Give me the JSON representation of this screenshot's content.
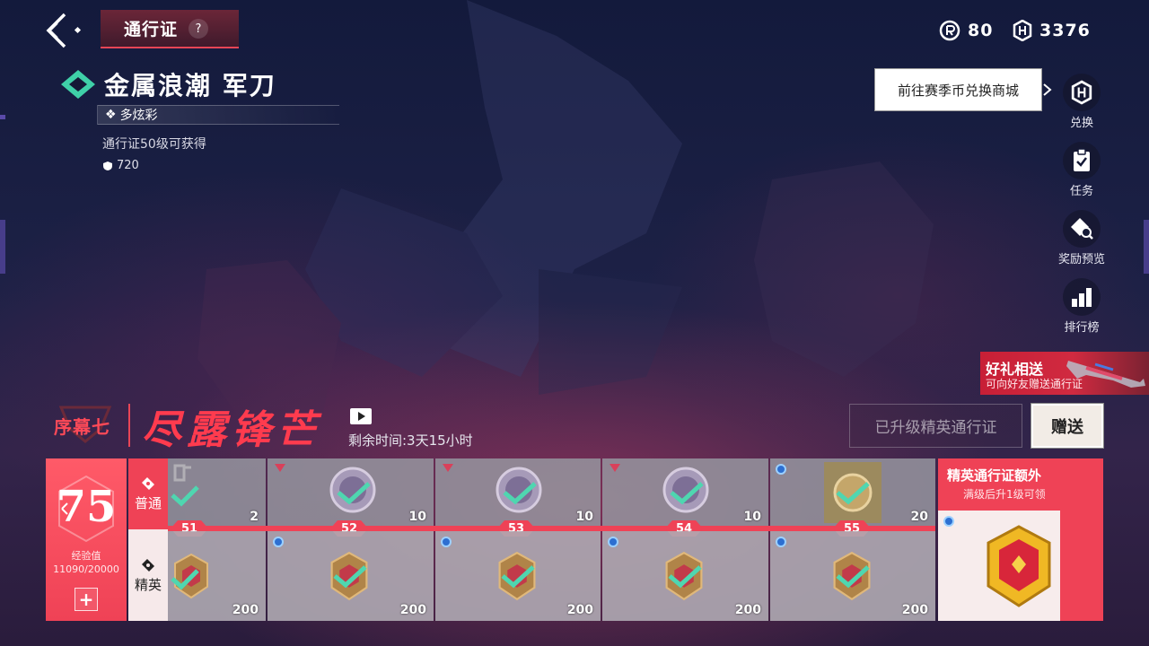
{
  "header": {
    "title": "通行证",
    "help": "?",
    "currencies": [
      {
        "icon": "radianite-icon",
        "value": "80"
      },
      {
        "icon": "kingdom-credit-icon",
        "value": "3376"
      }
    ]
  },
  "item": {
    "name": "金属浪潮 军刀",
    "variant": "多炫彩",
    "unlock_text": "通行证50级可获得",
    "points": "720"
  },
  "side_menu": {
    "tooltip": "前往赛季币兑换商城",
    "items": [
      {
        "icon": "exchange-icon",
        "label": "兑换"
      },
      {
        "icon": "missions-icon",
        "label": "任务"
      },
      {
        "icon": "reward-preview-icon",
        "label": "奖励预览"
      },
      {
        "icon": "leaderboard-icon",
        "label": "排行榜"
      }
    ]
  },
  "gift_banner": {
    "title": "好礼相送",
    "subtitle": "可向好友赠送通行证"
  },
  "act": {
    "label": "序幕七",
    "title": "尽露锋芒",
    "time_remaining": "剩余时间:3天15小时"
  },
  "buttons": {
    "upgraded": "已升级精英通行证",
    "send": "赠送"
  },
  "progress": {
    "level": "75",
    "xp_label": "经验值",
    "xp_value": "11090/20000",
    "xp_fraction": 0.5545,
    "plus": "+"
  },
  "lanes": {
    "normal": "普通",
    "elite": "精英"
  },
  "track": {
    "levels": [
      "51",
      "52",
      "53",
      "54",
      "55"
    ],
    "normal_qty": [
      "2",
      "10",
      "10",
      "10",
      "20"
    ],
    "elite_qty": [
      "200",
      "200",
      "200",
      "200",
      "200"
    ]
  },
  "extra": {
    "title": "精英通行证额外",
    "subtitle": "满级后升1级可领"
  },
  "colors": {
    "accent": "#ef4256",
    "check": "#4fd6b0",
    "background": "#141936"
  }
}
